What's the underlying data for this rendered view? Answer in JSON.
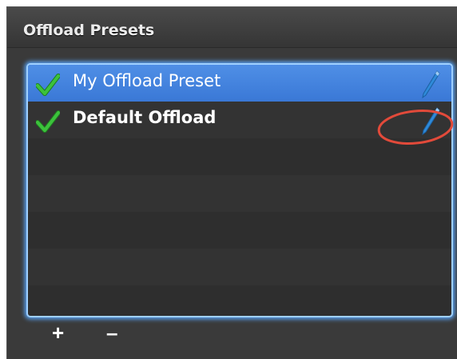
{
  "panel": {
    "title": "Offload Presets",
    "presets": [
      {
        "label": "My Offload Preset",
        "selected": true,
        "checked": true
      },
      {
        "label": "Default Offload",
        "selected": false,
        "checked": true
      }
    ],
    "add_label": "+",
    "remove_label": "–"
  },
  "icons": {
    "check": "checkmark-icon",
    "edit": "pencil-icon"
  },
  "colors": {
    "selection": "#3a78d6",
    "focus_ring": "#5aa9ff",
    "check": "#3cc23c",
    "pencil": "#2f8ad9",
    "annotation": "#e24a3a"
  }
}
